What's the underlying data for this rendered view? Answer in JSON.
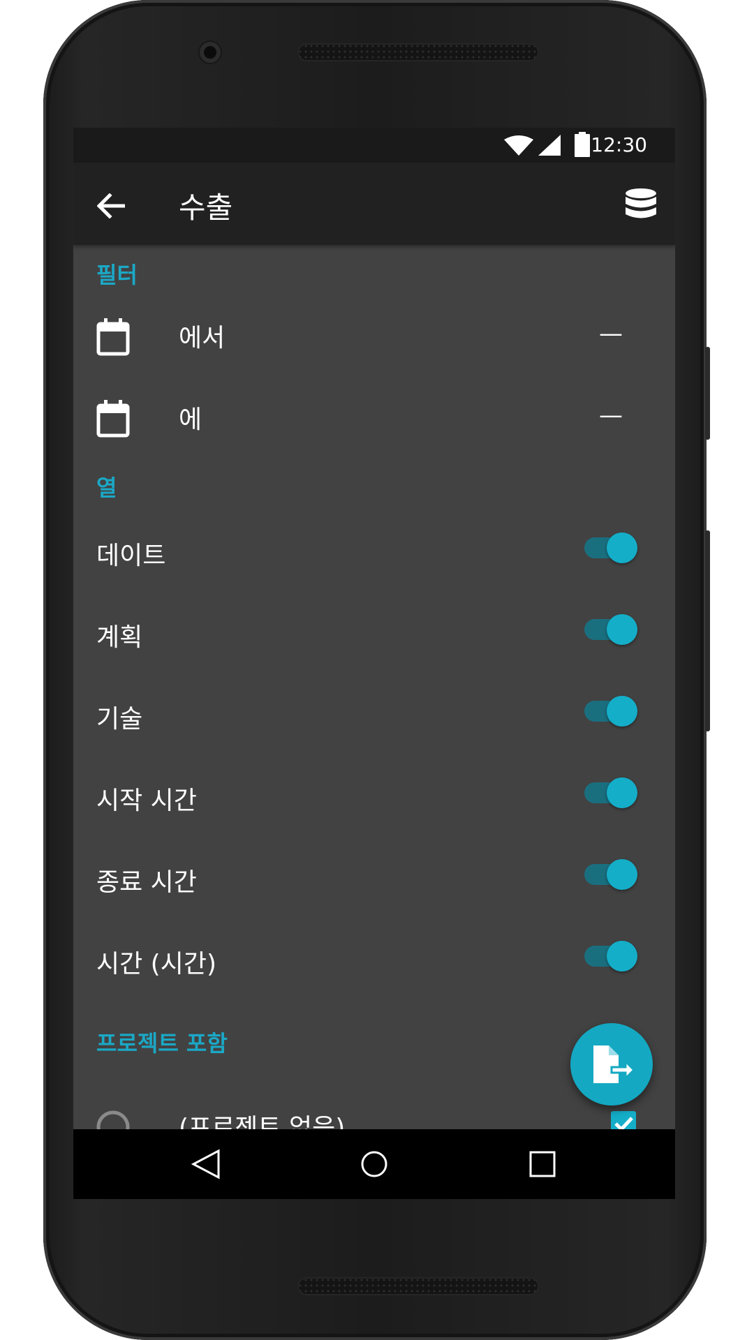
{
  "colors": {
    "accent": "#14aec9",
    "background": "#424242",
    "toolbar": "#212121",
    "status_bar": "#1a1a1a"
  },
  "status_bar": {
    "time": "12:30",
    "icons": [
      "wifi-icon",
      "cell-signal-icon",
      "battery-icon"
    ]
  },
  "toolbar": {
    "title": "수출",
    "back_icon": "arrow-left-icon",
    "action_icon": "database-icon"
  },
  "filter_section": {
    "header": "필터",
    "rows": [
      {
        "label": "에서",
        "value": "—",
        "icon": "calendar-icon"
      },
      {
        "label": "에",
        "value": "—",
        "icon": "calendar-icon"
      }
    ]
  },
  "columns_section": {
    "header": "열",
    "rows": [
      {
        "label": "데이트",
        "checked": true
      },
      {
        "label": "계획",
        "checked": true
      },
      {
        "label": "기술",
        "checked": true
      },
      {
        "label": "시작 시간",
        "checked": true
      },
      {
        "label": "종료 시간",
        "checked": true
      },
      {
        "label": "시간 (시간)",
        "checked": true
      }
    ]
  },
  "projects_section": {
    "header": "프로젝트 포함",
    "rows": [
      {
        "label": "(프로젝트 없음)",
        "checked": true
      }
    ]
  },
  "fab": {
    "icon": "file-export-icon"
  },
  "nav_bar": {
    "icons": [
      "back-triangle-icon",
      "home-circle-icon",
      "recents-square-icon"
    ]
  }
}
